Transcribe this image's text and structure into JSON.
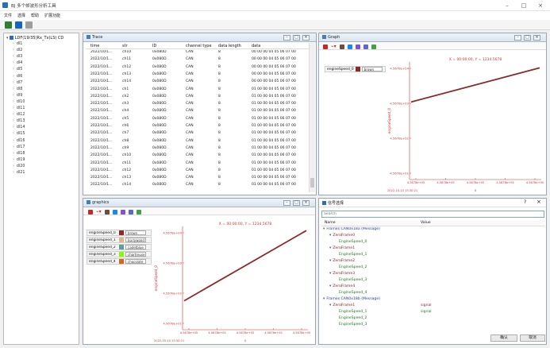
{
  "app": {
    "title": "BJ 多个帧波形分析工具",
    "menus": [
      "文件",
      "选择",
      "帮助",
      "扩展功能"
    ]
  },
  "tree": {
    "root": "LDF(19/35)Rx_Tx(LS) CD",
    "items": [
      "dl1",
      "dl2",
      "dl3",
      "dl4",
      "dl5",
      "dl6",
      "dl7",
      "dl8",
      "dl9",
      "dl10",
      "dl11",
      "dl12",
      "dl13",
      "dl14",
      "dl15",
      "dl16",
      "dl17",
      "dl18",
      "dl19",
      "dl20",
      "dl21"
    ]
  },
  "trace": {
    "title": "Trace",
    "headers": [
      "time",
      "str",
      "ID",
      "channel type",
      "data length",
      "data"
    ],
    "rows": [
      [
        "2022/10/1...",
        "ch10",
        "0x080D",
        "CAN",
        "8",
        "00 00 00 04 05 06 07 00"
      ],
      [
        "2022/10/1...",
        "ch11",
        "0x080D",
        "CAN",
        "8",
        "00 00 00 04 05 06 07 00"
      ],
      [
        "2022/10/1...",
        "ch12",
        "0x080D",
        "CAN",
        "8",
        "00 00 00 04 05 06 07 00"
      ],
      [
        "2022/10/1...",
        "ch13",
        "0x080D",
        "CAN",
        "8",
        "00 00 00 04 05 06 07 00"
      ],
      [
        "2022/10/1...",
        "ch14",
        "0x080D",
        "CAN",
        "8",
        "00 00 00 04 05 06 07 00"
      ],
      [
        "2022/10/1...",
        "ch1",
        "0x080D",
        "CAN",
        "8",
        "01 00 00 04 05 06 07 00"
      ],
      [
        "2022/10/1...",
        "ch2",
        "0x080D",
        "CAN",
        "8",
        "01 00 00 04 05 06 07 00"
      ],
      [
        "2022/10/1...",
        "ch3",
        "0x080D",
        "CAN",
        "8",
        "01 00 00 04 05 06 07 00"
      ],
      [
        "2022/10/1...",
        "ch4",
        "0x080D",
        "CAN",
        "8",
        "01 00 00 04 05 06 07 00"
      ],
      [
        "2022/10/1...",
        "ch5",
        "0x080D",
        "CAN",
        "8",
        "01 00 00 04 05 06 07 00"
      ],
      [
        "2022/10/1...",
        "ch6",
        "0x080D",
        "CAN",
        "8",
        "01 00 00 04 05 06 07 00"
      ],
      [
        "2022/10/1...",
        "ch7",
        "0x080D",
        "CAN",
        "8",
        "01 00 00 04 05 06 07 00"
      ],
      [
        "2022/10/1...",
        "ch8",
        "0x080D",
        "CAN",
        "8",
        "01 00 00 04 05 06 07 00"
      ],
      [
        "2022/10/1...",
        "ch9",
        "0x080D",
        "CAN",
        "8",
        "01 00 00 04 05 06 07 00"
      ],
      [
        "2022/10/1...",
        "ch10",
        "0x080D",
        "CAN",
        "8",
        "01 00 00 04 05 06 07 00"
      ],
      [
        "2022/10/1...",
        "ch11",
        "0x080D",
        "CAN",
        "8",
        "01 00 00 04 05 06 07 00"
      ],
      [
        "2022/10/1...",
        "ch12",
        "0x080D",
        "CAN",
        "8",
        "01 00 00 04 05 06 07 00"
      ],
      [
        "2022/10/1...",
        "ch13",
        "0x080D",
        "CAN",
        "8",
        "01 00 00 04 05 06 07 00"
      ],
      [
        "2022/10/1...",
        "ch14",
        "0x080D",
        "CAN",
        "8",
        "01 00 00 04 05 06 07 00"
      ]
    ]
  },
  "graph1": {
    "title": "Graph",
    "signal": {
      "name": "engineSpeed_0",
      "color_label": "brown",
      "color": "#8b2a2a"
    },
    "readout": "X = 00:00:00, Y = 1234.5678",
    "ylabel": "engineSpeed_0",
    "yticks": [
      "4.5678e+04",
      "4.5678e+03",
      "4.5678e+02",
      "4.5678e+01"
    ],
    "xticks": [
      "4.5678e+05",
      "4.5678e+05",
      "4.5678e+05",
      "4.5678e+05",
      "4.5678e+05"
    ],
    "xfoot": "2022-10-10 15:30:21",
    "xlabel": "x"
  },
  "graph2": {
    "title": "graphics",
    "signals": [
      {
        "name": "engineSpeed_0",
        "color_label": "brown",
        "color": "#8b2a2a"
      },
      {
        "name": "engineSpeed_1",
        "color_label": "burlywood",
        "color": "#deb887"
      },
      {
        "name": "engineSpeed_2",
        "color_label": "cadetblue",
        "color": "#5f9ea0"
      },
      {
        "name": "engineSpeed_3",
        "color_label": "chartreuse",
        "color": "#7fff00"
      },
      {
        "name": "engineSpeed_4",
        "color_label": "chocolate",
        "color": "#d2691e"
      }
    ],
    "readout": "X = 00:00:00, Y = 1234.5678",
    "ylabel": "engineSpeed_0",
    "yticks": [
      "4.5678e+04",
      "4.5678e+03",
      "4.5678e+02",
      "4.5678e+01"
    ],
    "xticks": [
      "4.5678e+05",
      "4.5678e+05",
      "4.5678e+05",
      "4.5678e+05",
      "4.5678e+05"
    ],
    "xfoot": "2022-10-10 15:30:21",
    "xlabel": "x"
  },
  "signal_dialog": {
    "title": "信号选择",
    "help": "?",
    "close": "×",
    "search_placeholder": "Search",
    "col_name": "Name",
    "col_value": "Value",
    "items": [
      {
        "label": "Frames:CAN0x18a (Message)",
        "level": 0,
        "color": "#1a3fa0",
        "value": ""
      },
      {
        "label": "ZeroFrame0",
        "level": 1,
        "color": "#8b2020",
        "value": ""
      },
      {
        "label": "EngineSpeed_0",
        "level": 2,
        "color": "#1e7a1e",
        "value": ""
      },
      {
        "label": "ZeroFrame1",
        "level": 1,
        "color": "#8b2020",
        "value": ""
      },
      {
        "label": "EngineSpeed_1",
        "level": 2,
        "color": "#1e7a1e",
        "value": ""
      },
      {
        "label": "ZeroFrame2",
        "level": 1,
        "color": "#8b2020",
        "value": ""
      },
      {
        "label": "EngineSpeed_2",
        "level": 2,
        "color": "#1e7a1e",
        "value": ""
      },
      {
        "label": "ZeroFrame3",
        "level": 1,
        "color": "#8b2020",
        "value": ""
      },
      {
        "label": "EngineSpeed_3",
        "level": 2,
        "color": "#1e7a1e",
        "value": ""
      },
      {
        "label": "ZeroFrame4",
        "level": 1,
        "color": "#8b2020",
        "value": ""
      },
      {
        "label": "EngineSpeed_4",
        "level": 2,
        "color": "#1e7a1e",
        "value": ""
      },
      {
        "label": "Frames:CAN0x18b (Message)",
        "level": 0,
        "color": "#1a3fa0",
        "value": ""
      },
      {
        "label": "ZeroFrame1",
        "level": 1,
        "color": "#8b2020",
        "value": "signal"
      },
      {
        "label": "EngineSpeed_1",
        "level": 2,
        "color": "#1e7a1e",
        "value": "signal"
      },
      {
        "label": "EngineSpeed_2",
        "level": 2,
        "color": "#1e7a1e",
        "value": ""
      },
      {
        "label": "EngineSpeed_3",
        "level": 2,
        "color": "#1e7a1e",
        "value": ""
      }
    ],
    "ok": "确认",
    "cancel": "取消"
  }
}
